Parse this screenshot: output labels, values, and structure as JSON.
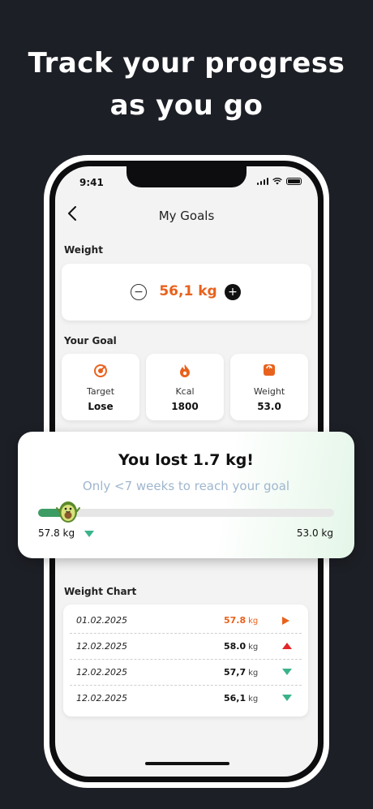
{
  "promo": {
    "line1": "Track your progress",
    "line2": "as you go"
  },
  "status_bar": {
    "time": "9:41"
  },
  "nav": {
    "back_icon": "chevron-left-icon",
    "title": "My Goals"
  },
  "weight": {
    "label": "Weight",
    "value": "56,1 kg",
    "minus": "−",
    "plus": "+",
    "accent": "#e8621d"
  },
  "goal": {
    "label": "Your Goal",
    "cards": [
      {
        "icon": "target-icon",
        "label": "Target",
        "value": "Lose"
      },
      {
        "icon": "flame-icon",
        "label": "Kcal",
        "value": "1800"
      },
      {
        "icon": "scale-icon",
        "label": "Weight",
        "value": "53.0"
      }
    ]
  },
  "progress": {
    "title": "You lost 1.7 kg!",
    "subtitle": "Only <7 weeks to reach your goal",
    "start": "57.8 kg",
    "end": "53.0 kg",
    "fraction": 0.1,
    "fill_color": "#3d9c63",
    "mascot_icon": "avocado-icon"
  },
  "chart": {
    "label": "Weight Chart",
    "rows": [
      {
        "date": "01.02.2025",
        "value": "57.8",
        "unit": "kg",
        "trend": "right",
        "highlight": true
      },
      {
        "date": "12.02.2025",
        "value": "58.0",
        "unit": "kg",
        "trend": "up",
        "highlight": false
      },
      {
        "date": "12.02.2025",
        "value": "57,7",
        "unit": "kg",
        "trend": "down",
        "highlight": false
      },
      {
        "date": "12.02.2025",
        "value": "56,1",
        "unit": "kg",
        "trend": "down",
        "highlight": false
      }
    ],
    "colors": {
      "right": "#e8621d",
      "up": "#e3262a",
      "down": "#3bb38a"
    }
  }
}
